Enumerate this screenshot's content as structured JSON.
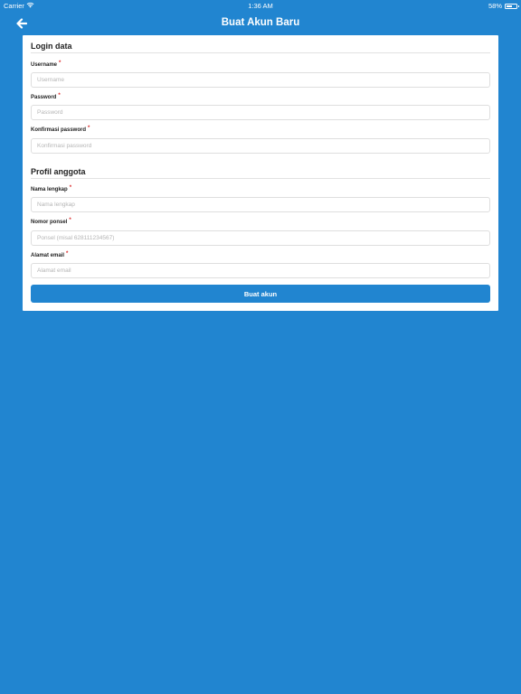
{
  "status_bar": {
    "carrier": "Carrier",
    "time": "1:36 AM",
    "battery": "58%",
    "battery_level": 0.58
  },
  "nav": {
    "title": "Buat Akun Baru",
    "back_icon": "arrow-left-icon"
  },
  "colors": {
    "background": "#2185d0",
    "primary": "#2185d0",
    "required": "#db2828"
  },
  "form": {
    "login_section": {
      "title": "Login data",
      "fields": [
        {
          "label": "Username",
          "required": "*",
          "placeholder": "Username",
          "value": ""
        },
        {
          "label": "Password",
          "required": "*",
          "placeholder": "Password",
          "value": ""
        },
        {
          "label": "Konfirmasi password",
          "required": "*",
          "placeholder": "Konfirmasi password",
          "value": ""
        }
      ]
    },
    "profile_section": {
      "title": "Profil anggota",
      "fields": [
        {
          "label": "Nama lengkap",
          "required": "*",
          "placeholder": "Nama lengkap",
          "value": ""
        },
        {
          "label": "Nomor ponsel",
          "required": "*",
          "placeholder": "Ponsel (misal 628111234567)",
          "value": ""
        },
        {
          "label": "Alamat email",
          "required": "*",
          "placeholder": "Alamat email",
          "value": ""
        }
      ]
    },
    "submit_label": "Buat akun"
  }
}
